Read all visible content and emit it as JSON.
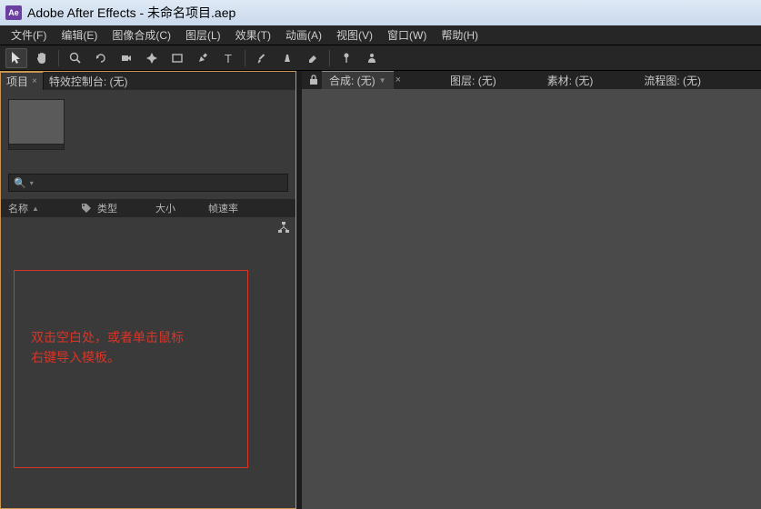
{
  "window": {
    "app_icon_text": "Ae",
    "title": "Adobe After Effects - 未命名项目.aep"
  },
  "menubar": {
    "items": [
      "文件(F)",
      "编辑(E)",
      "图像合成(C)",
      "图层(L)",
      "效果(T)",
      "动画(A)",
      "视图(V)",
      "窗口(W)",
      "帮助(H)"
    ]
  },
  "toolbar": {
    "tools": [
      "selection",
      "hand",
      "zoom",
      "rotate",
      "camera",
      "pan-behind",
      "rect",
      "pen",
      "type",
      "brush",
      "clone",
      "eraser",
      "puppet",
      "roto"
    ]
  },
  "left_panel": {
    "tabs": {
      "project": "项目",
      "effects": "特效控制台: (无)"
    },
    "search_placeholder": "",
    "columns": {
      "name": "名称",
      "tag": "",
      "type": "类型",
      "size": "大小",
      "rate": "帧速率"
    },
    "hint_box": {
      "line1": "双击空白处，或者单击鼠标",
      "line2": "右键导入模板。"
    }
  },
  "viewer": {
    "tabs": {
      "composition": "合成: (无)",
      "layer": "图层: (无)",
      "footage": "素材: (无)",
      "flowchart": "流程图: (无)"
    }
  }
}
